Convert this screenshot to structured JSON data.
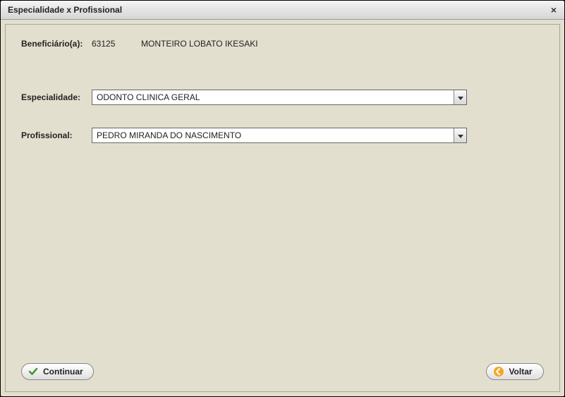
{
  "window": {
    "title": "Especialidade x Profissional"
  },
  "beneficiario": {
    "label": "Beneficiário(a):",
    "id": "63125",
    "name": "MONTEIRO LOBATO IKESAKI"
  },
  "especialidade": {
    "label": "Especialidade:",
    "value": "ODONTO CLINICA GERAL"
  },
  "profissional": {
    "label": "Profissional:",
    "value": "PEDRO MIRANDA DO NASCIMENTO"
  },
  "buttons": {
    "continuar": "Continuar",
    "voltar": "Voltar"
  }
}
